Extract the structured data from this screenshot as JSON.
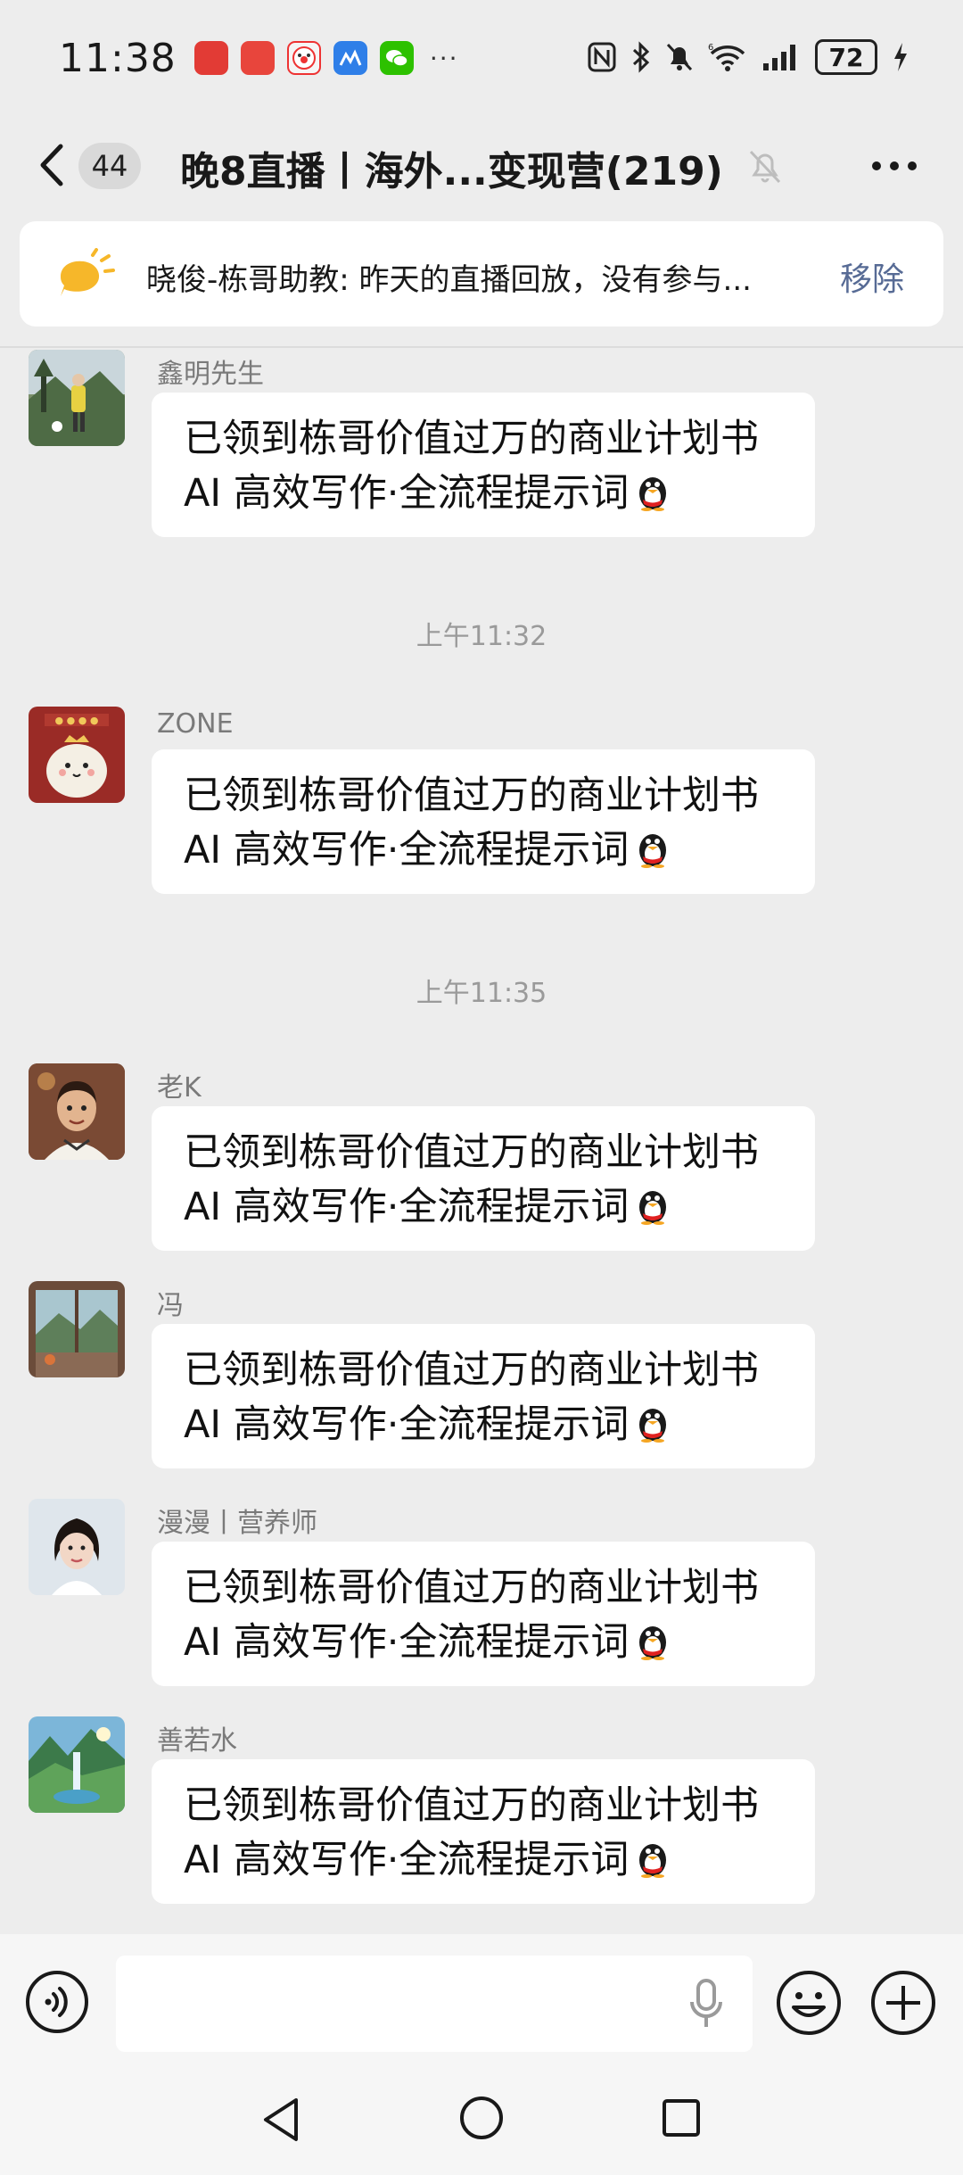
{
  "status": {
    "time": "11:38",
    "battery": "72",
    "notification_icons": [
      "huawei-store-icon",
      "huawei-mall-icon",
      "clown-app-icon",
      "blue-app-icon",
      "wechat-icon"
    ]
  },
  "header": {
    "unread_count": "44",
    "title": "晚8直播丨海外...变现营(219)"
  },
  "notice": {
    "text": "晓俊-栋哥助教: 昨天的直播回放，没有参与...",
    "action": "移除"
  },
  "messages": [
    {
      "sender": "鑫明先生",
      "line1": "已领到栋哥价值过万的商业计划书",
      "line2": "AI 高效写作·全流程提示词"
    },
    {
      "sender": "ZONE",
      "line1": "已领到栋哥价值过万的商业计划书",
      "line2": "AI 高效写作·全流程提示词"
    },
    {
      "sender": "老K",
      "line1": "已领到栋哥价值过万的商业计划书",
      "line2": "AI 高效写作·全流程提示词"
    },
    {
      "sender": "冯",
      "line1": "已领到栋哥价值过万的商业计划书",
      "line2": "AI 高效写作·全流程提示词"
    },
    {
      "sender": "漫漫丨营养师",
      "line1": "已领到栋哥价值过万的商业计划书",
      "line2": "AI 高效写作·全流程提示词"
    },
    {
      "sender": "善若水",
      "line1": "已领到栋哥价值过万的商业计划书",
      "line2": "AI 高效写作·全流程提示词"
    }
  ],
  "timestamps": [
    "上午11:32",
    "上午11:35"
  ],
  "colors": {
    "background": "#ededed",
    "bubble": "#ffffff",
    "link": "#576b95"
  }
}
